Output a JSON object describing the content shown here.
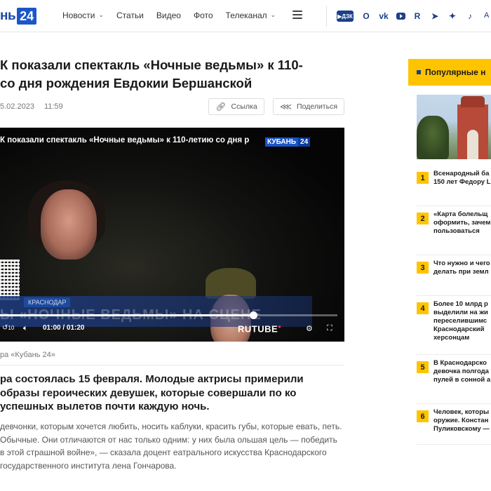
{
  "header": {
    "logo_text": "нь",
    "logo_badge": "24",
    "nav": [
      {
        "label": "Новости",
        "has_dropdown": true
      },
      {
        "label": "Статьи",
        "has_dropdown": false
      },
      {
        "label": "Видео",
        "has_dropdown": false
      },
      {
        "label": "Фото",
        "has_dropdown": false
      },
      {
        "label": "Телеканал",
        "has_dropdown": true
      }
    ],
    "socials": [
      "dzen-icon",
      "ok-icon",
      "vk-icon",
      "youtube-icon",
      "rutube-icon",
      "telegram-icon",
      "star-icon",
      "tiktok-icon"
    ],
    "dzen_label": "▶ДЗК",
    "right_text": "А"
  },
  "article": {
    "title": "К показали спектакль «Ночные ведьмы» к 110-\nсо дня рождения Евдокии Бершанской",
    "date": "5.02.2023",
    "time": "11:59",
    "link_button": "Ссылка",
    "share_button": "Поделиться",
    "video": {
      "title": "К показали спектакль «Ночные ведьмы» к 110-летию со дня р",
      "logo_text": "КУБАНЬ",
      "logo_num": "24",
      "city_tag": "КРАСНОДАР",
      "lower_text": "Ы «НОЧНЫЕ ВЕДЬМЫ» НА СЦЕНЕ",
      "time_display": "01:00 / 01:20",
      "progress": 0.75,
      "player_brand": "RUTUBE",
      "rewind_label": "10"
    },
    "caption": "ра «Кубань 24»",
    "lead": "ра состоялась 15 февраля. Молодые актрисы примерили образы героических девушек, которые совершали по ко успешных вылетов почти каждую ночь.",
    "paragraph": "девчонки, которым хочется любить, носить каблуки, красить губы, которые евать, петь. Обычные. Они отличаются от нас только одним: у них была ольшая цель — победить в этой страшной войне», — сказала доцент еатрального искусства Краснодарского государственного института лена Гончарова."
  },
  "sidebar": {
    "title": "Популярные н",
    "items": [
      {
        "num": "1",
        "text": "Всенародный ба\n150 лет Федору L"
      },
      {
        "num": "2",
        "text": "«Карта болельщ\nоформить, зачем\nпользоваться"
      },
      {
        "num": "3",
        "text": "Что нужно и чего\nделать при земл"
      },
      {
        "num": "4",
        "text": "Более 10 млрд р\nвыделили на жи\nпереселившимс\nКраснодарский\nхерсонцам"
      },
      {
        "num": "5",
        "text": "В Краснодарско\nдевочка полгода\nпулей в сонной а"
      },
      {
        "num": "6",
        "text": "Человек, которы\nоружие. Констан\nПуликовскому —"
      }
    ]
  },
  "colors": {
    "brand_blue": "#1c56c9",
    "accent_yellow": "#ffc400",
    "icon_blue": "#1c3f8a"
  }
}
